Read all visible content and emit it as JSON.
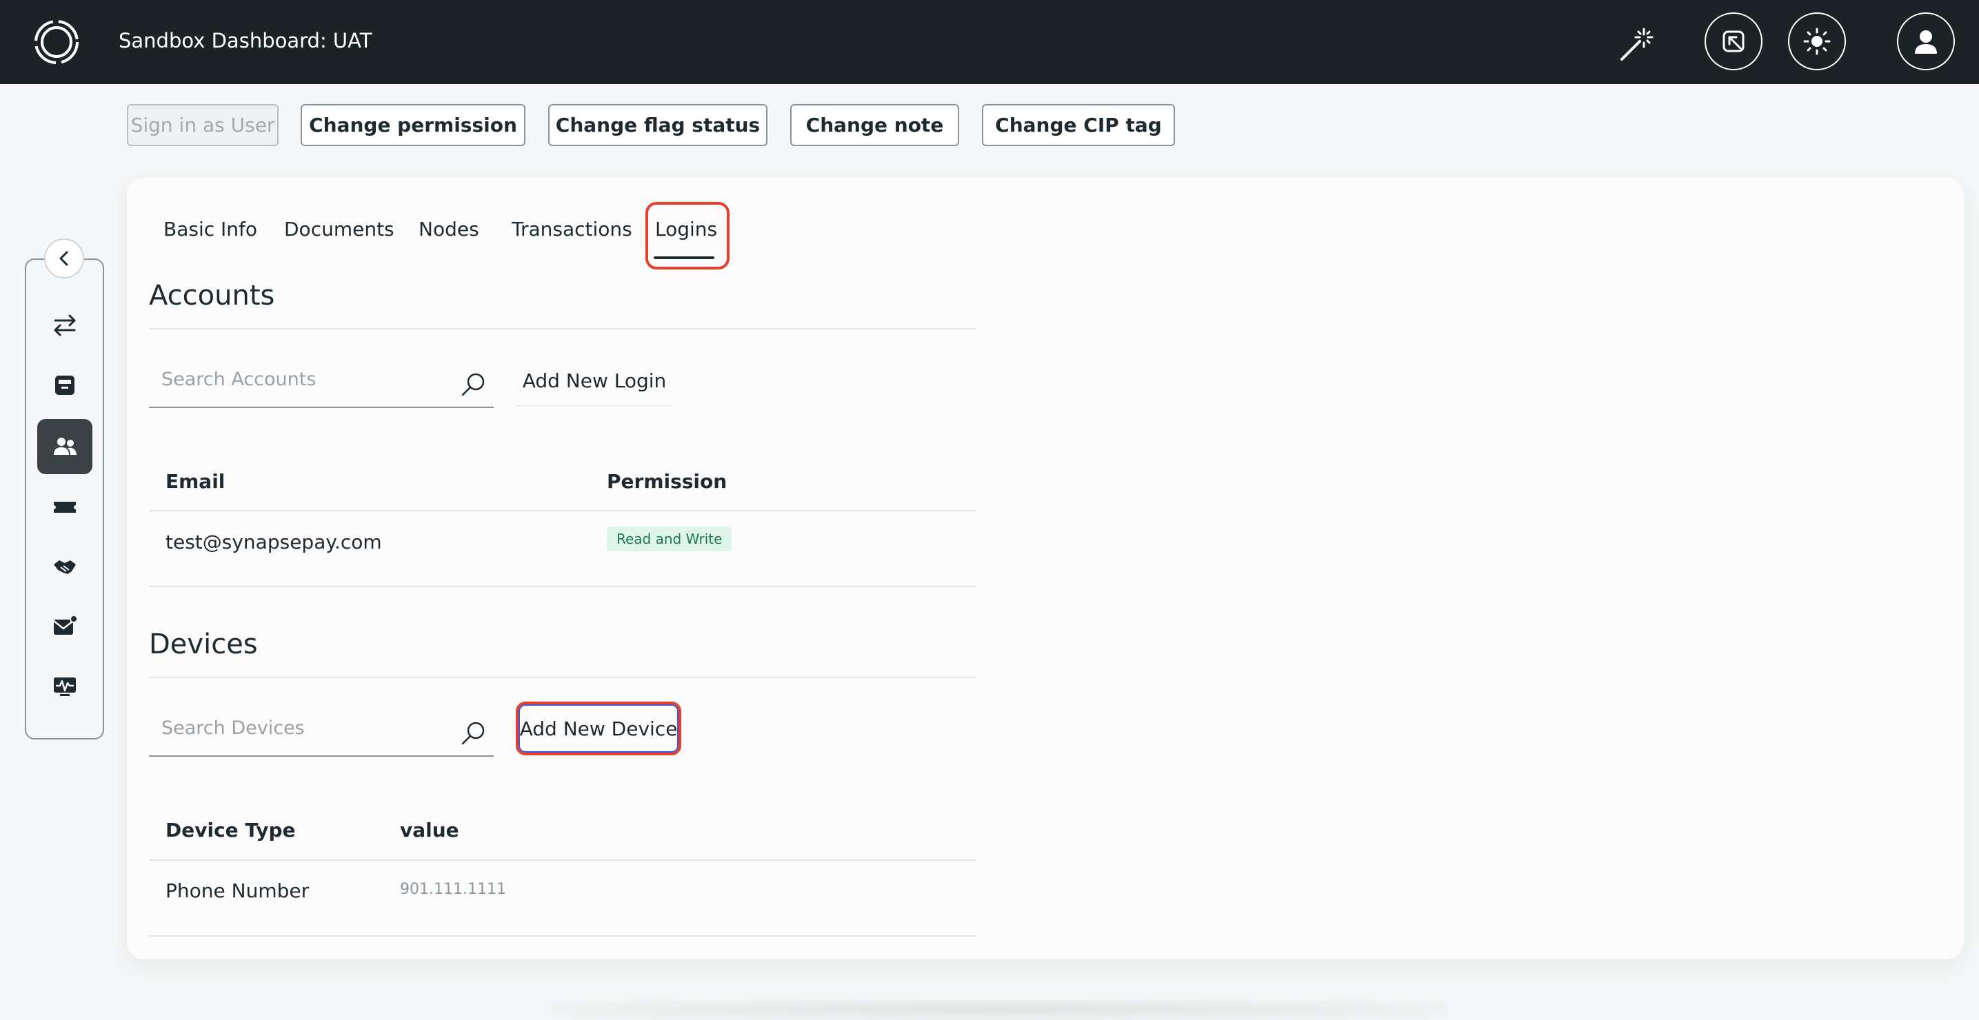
{
  "header": {
    "title": "Sandbox Dashboard: UAT",
    "icons": [
      "logo-icon",
      "magic-wand-icon",
      "exit-icon",
      "theme-sun-icon",
      "user-avatar-icon"
    ],
    "bg_color": "#1c2326"
  },
  "actions": {
    "sign_in_as_user": "Sign in as User",
    "change_permission": "Change permission",
    "change_flag_status": "Change flag status",
    "change_note": "Change note",
    "change_cip_tag": "Change CIP tag"
  },
  "sidebar": {
    "items": [
      "transfer-icon",
      "inbox-icon",
      "users-icon",
      "ticket-icon",
      "handshake-icon",
      "mail-notification-icon",
      "monitor-activity-icon"
    ],
    "active": "users-icon"
  },
  "tabs": [
    {
      "label": "Basic Info"
    },
    {
      "label": "Documents"
    },
    {
      "label": "Nodes"
    },
    {
      "label": "Transactions"
    },
    {
      "label": "Logins"
    }
  ],
  "accounts": {
    "title": "Accounts",
    "search_placeholder": "Search Accounts",
    "add_label": "Add New Login",
    "columns": [
      "Email",
      "Permission"
    ],
    "rows": [
      {
        "email": "test@synapsepay.com",
        "permission": "Read and Write"
      }
    ]
  },
  "devices": {
    "title": "Devices",
    "search_placeholder": "Search Devices",
    "add_label": "Add New Device",
    "columns": [
      "Device Type",
      "value"
    ],
    "rows": [
      {
        "type": "Phone Number",
        "value": "901.111.1111"
      }
    ]
  },
  "colors": {
    "highlight": "#e5402f",
    "badge_bg": "#dff5ea",
    "badge_text": "#1d7a4c"
  }
}
